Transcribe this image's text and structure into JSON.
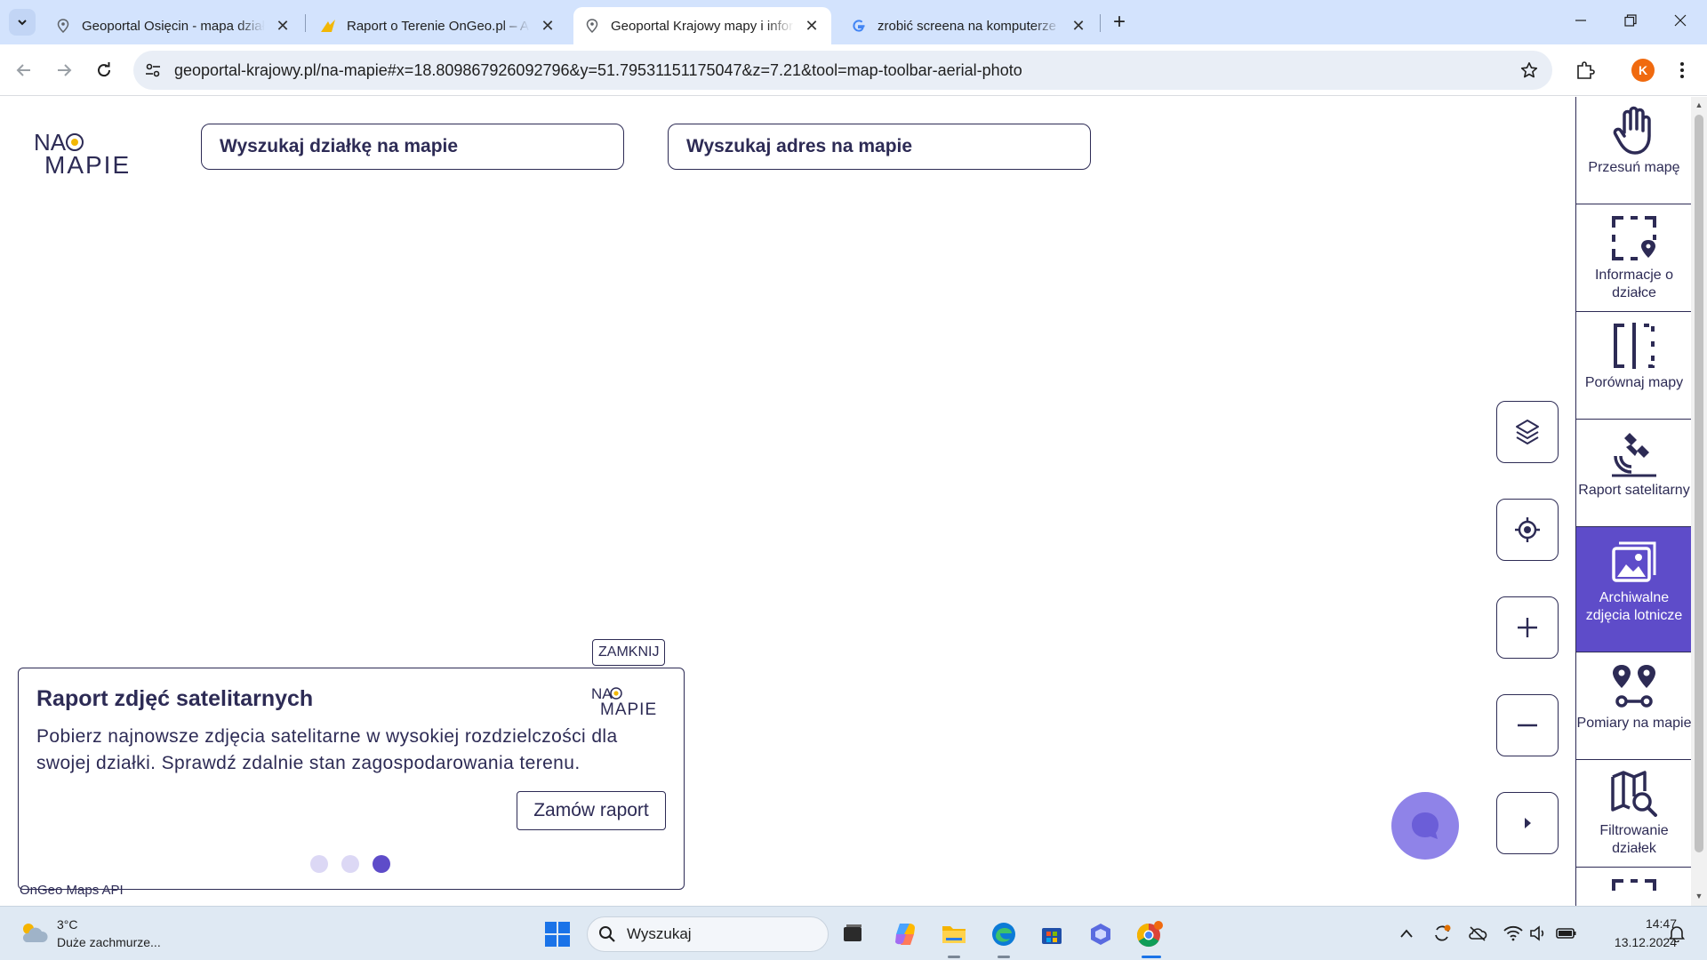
{
  "browser": {
    "tabs": [
      {
        "title": "Geoportal Osięcin - mapa działek",
        "active": false
      },
      {
        "title": "Raport o Terenie OnGeo.pl – Analiza",
        "active": false
      },
      {
        "title": "Geoportal Krajowy mapy i informacje",
        "active": true
      },
      {
        "title": "zrobić screena na komputerze - Google",
        "active": false
      }
    ],
    "url_host": "geoportal-krajowy.pl",
    "url_path": "/na-mapie#x=18.809867926092796&y=51.79531151175047&z=7.21&tool=map-toolbar-aerial-photo",
    "profile_initial": "K"
  },
  "page": {
    "logo_text_top": "NA",
    "logo_text_bottom": "MAPIE",
    "search_parcel_placeholder": "Wyszukaj działkę na mapie",
    "search_address_placeholder": "Wyszukaj adres na mapie",
    "tools": [
      {
        "label": "Przesuń mapę",
        "icon": "hand-icon",
        "active": false
      },
      {
        "label": "Informacje o działce",
        "icon": "parcel-info-icon",
        "active": false
      },
      {
        "label": "Porównaj mapy",
        "icon": "compare-maps-icon",
        "active": false
      },
      {
        "label": "Raport satelitarny",
        "icon": "satellite-icon",
        "active": false
      },
      {
        "label": "Archiwalne zdjęcia lotnicze",
        "icon": "aerial-photo-icon",
        "active": true
      },
      {
        "label": "Pomiary na mapie",
        "icon": "measure-icon",
        "active": false
      },
      {
        "label": "Filtrowanie działek",
        "icon": "filter-map-icon",
        "active": false
      }
    ],
    "promo": {
      "close_label": "ZAMKNIJ",
      "title": "Raport zdjęć satelitarnych",
      "text": "Pobierz najnowsze zdjęcia satelitarne w wysokiej rozdzielczości dla swojej działki. Sprawdź zdalnie stan zagospodarowania terenu.",
      "button": "Zamów raport",
      "slides_total": 3,
      "slide_active": 3
    },
    "attribution": "OnGeo Maps API"
  },
  "taskbar": {
    "weather_temp": "3°C",
    "weather_desc": "Duże zachmurze...",
    "search_placeholder": "Wyszukaj",
    "time": "14:47",
    "date": "13.12.2024"
  },
  "colors": {
    "brand_navy": "#2d2b55",
    "brand_purple": "#5e4cc9",
    "tab_strip": "#d3e3fd"
  }
}
